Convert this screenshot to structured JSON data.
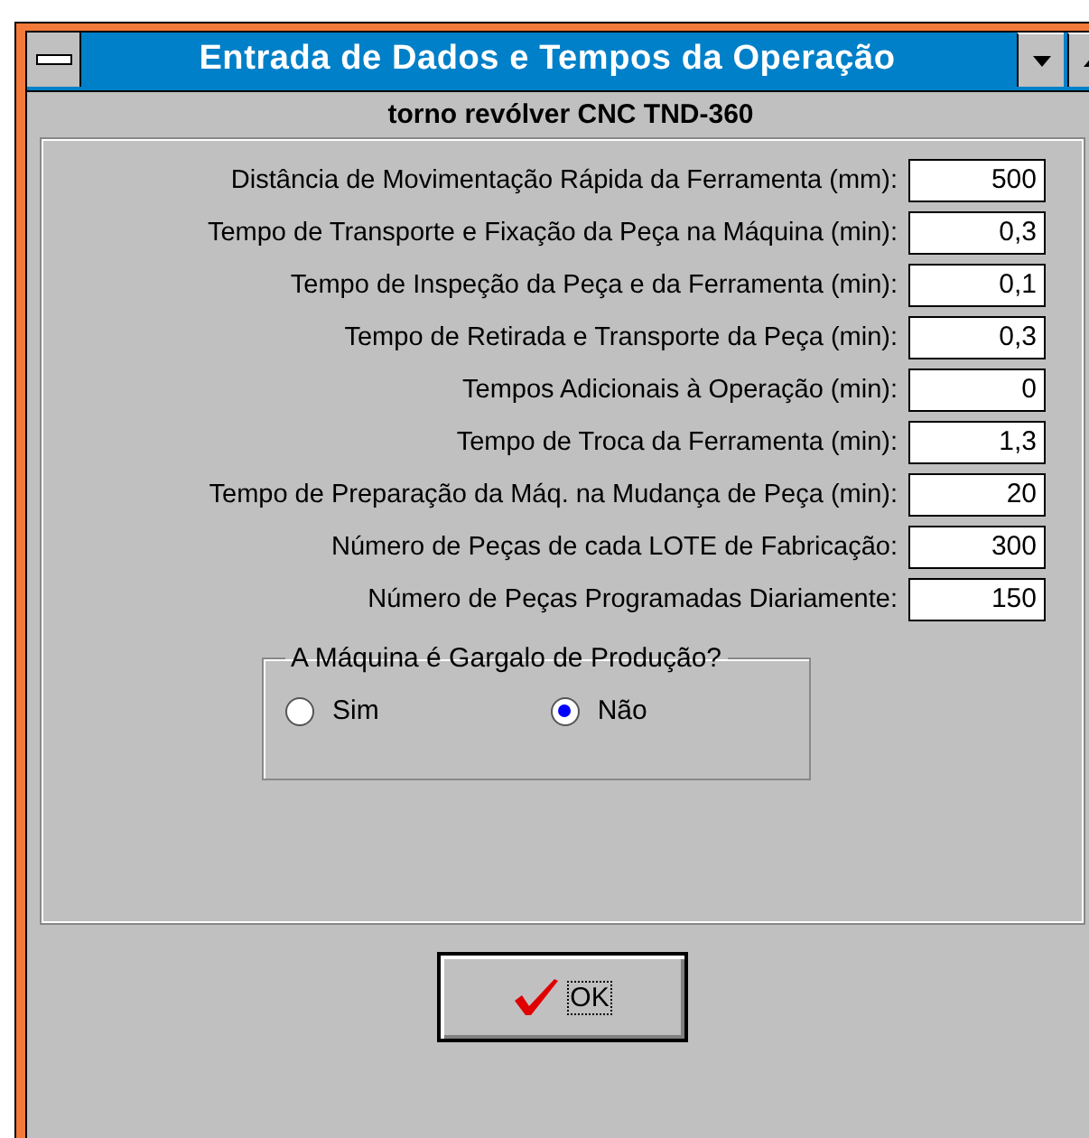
{
  "window": {
    "title": "Entrada de Dados e Tempos da Operação",
    "subtitle": "torno revólver CNC TND-360"
  },
  "fields": [
    {
      "label": "Distância de Movimentação Rápida da Ferramenta (mm):",
      "value": "500"
    },
    {
      "label": "Tempo de Transporte e Fixação da Peça na Máquina (min):",
      "value": "0,3"
    },
    {
      "label": "Tempo de Inspeção da Peça e da Ferramenta (min):",
      "value": "0,1"
    },
    {
      "label": "Tempo de Retirada e Transporte da Peça (min):",
      "value": "0,3"
    },
    {
      "label": "Tempos Adicionais à Operação (min):",
      "value": "0"
    },
    {
      "label": "Tempo de Troca da Ferramenta (min):",
      "value": "1,3"
    },
    {
      "label": "Tempo de Preparação da Máq. na Mudança de Peça (min):",
      "value": "20"
    },
    {
      "label": "Número de Peças de cada LOTE de Fabricação:",
      "value": "300"
    },
    {
      "label": "Número de Peças Programadas Diariamente:",
      "value": "150"
    }
  ],
  "group": {
    "title": "A Máquina é Gargalo de Produção?",
    "options": [
      {
        "label": "Sim",
        "selected": false
      },
      {
        "label": "Não",
        "selected": true
      }
    ]
  },
  "buttons": [
    {
      "label": "OK"
    }
  ]
}
